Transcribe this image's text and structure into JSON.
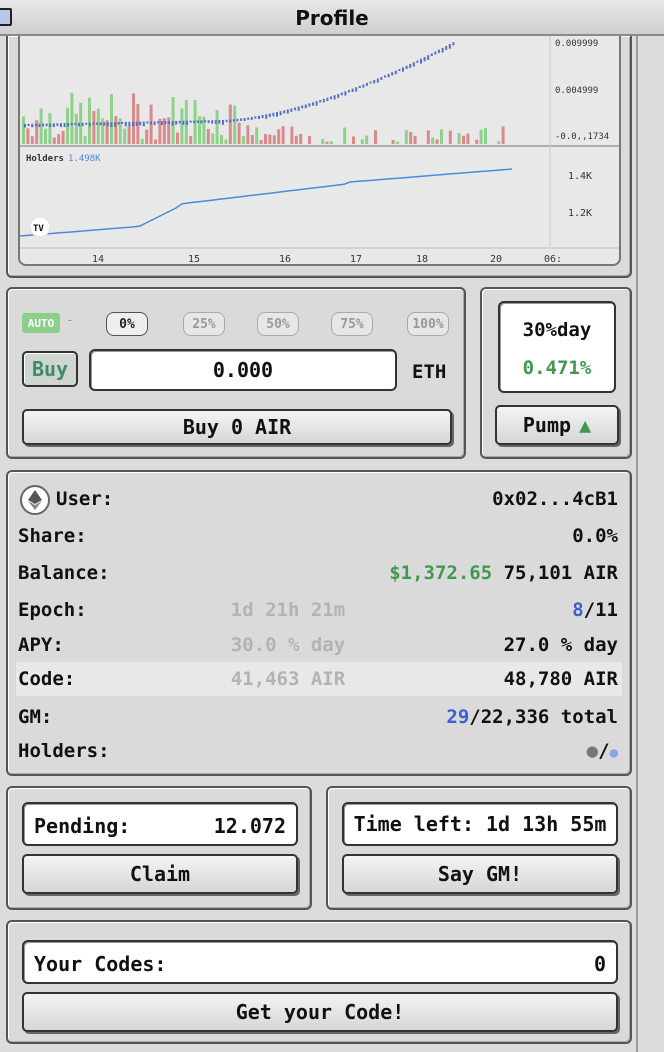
{
  "window": {
    "title": "Profile"
  },
  "chart": {
    "price_ticks": [
      "0.009999",
      "0.004999",
      "-0.0,,1734"
    ],
    "holders_label": "Holders",
    "holders_value": "1.498K",
    "holders_ticks": [
      "1.4K",
      "1.2K"
    ],
    "x_ticks": [
      "14",
      "15",
      "16",
      "17",
      "18",
      "20",
      "06:"
    ],
    "logo": "TV",
    "up_color": "#8fd18a",
    "down_color": "#d98a8a",
    "line_color": "#4a8ad8"
  },
  "buy": {
    "auto_label": "AUTO",
    "auto_dash": "-",
    "percents": [
      "0%",
      "25%",
      "50%",
      "75%",
      "100%"
    ],
    "buy_label": "Buy",
    "amount": "0.000",
    "currency": "ETH",
    "buy_air_label": "Buy 0 AIR"
  },
  "pump": {
    "rate_label": "30%day",
    "rate_value": "0.471%",
    "pump_label": "Pump",
    "pump_arrow": "▲"
  },
  "stats": {
    "user_label": "User:",
    "user_value": "0x02...4cB1",
    "share_label": "Share:",
    "share_value": "0.0%",
    "balance_label": "Balance:",
    "balance_usd": "$1,372.65",
    "balance_air": "75,101 AIR",
    "epoch_label": "Epoch:",
    "epoch_mid": "1d 21h 21m",
    "epoch_current": "8",
    "epoch_total": "/11",
    "apy_label": "APY:",
    "apy_mid": "30.0 % day",
    "apy_value": "27.0 % day",
    "code_label": "Code:",
    "code_mid": "41,463 AIR",
    "code_value": "48,780 AIR",
    "gm_label": "GM:",
    "gm_current": "29",
    "gm_total": "/22,336 total",
    "holders_label": "Holders:",
    "holders_sep": "/"
  },
  "pending": {
    "label": "Pending:",
    "value": "12.072",
    "claim_label": "Claim"
  },
  "timeleft": {
    "label": "Time left:",
    "value": "1d 13h 55m",
    "gm_label": "Say GM!"
  },
  "codes": {
    "label": "Your Codes:",
    "value": "0",
    "get_label": "Get your Code!"
  }
}
